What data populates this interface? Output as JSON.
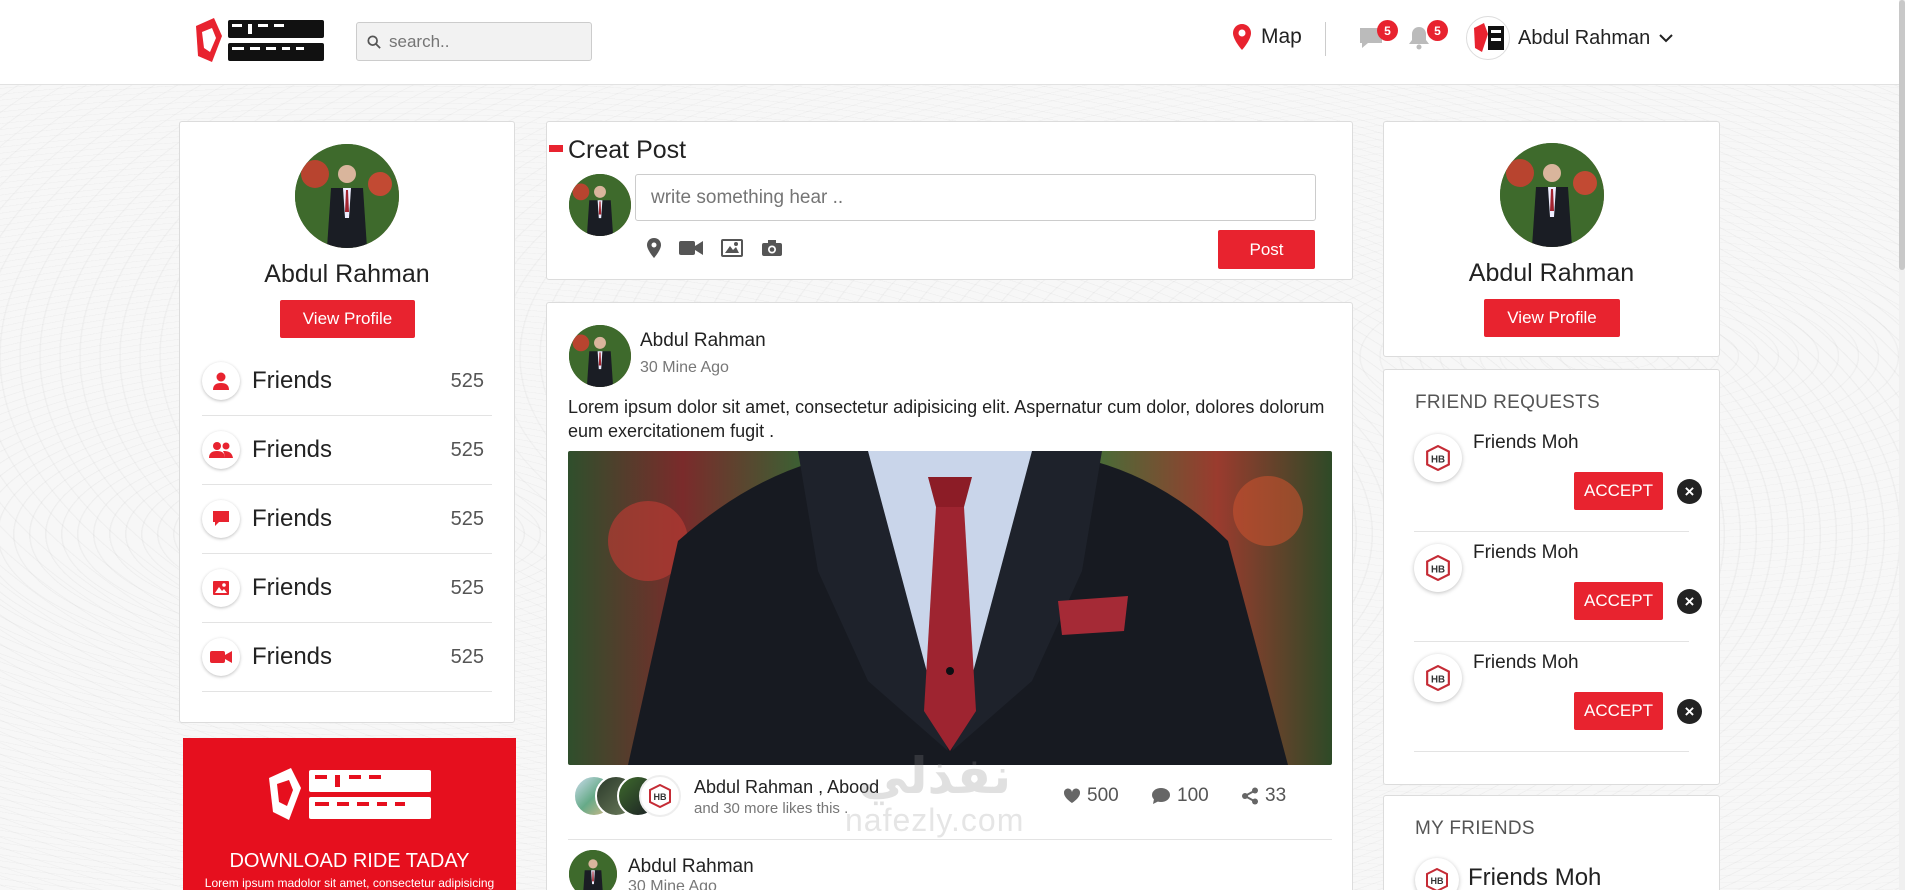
{
  "header": {
    "search_placeholder": "search..",
    "map_label": "Map",
    "messages_badge": "5",
    "notifications_badge": "5",
    "user_name": "Abdul Rahman"
  },
  "left": {
    "profile_name": "Abdul Rahman",
    "view_profile": "View Profile",
    "stats": [
      {
        "label": "Friends",
        "count": "525",
        "icon": "user-icon"
      },
      {
        "label": "Friends",
        "count": "525",
        "icon": "users-icon"
      },
      {
        "label": "Friends",
        "count": "525",
        "icon": "comment-icon"
      },
      {
        "label": "Friends",
        "count": "525",
        "icon": "image-icon"
      },
      {
        "label": "Friends",
        "count": "525",
        "icon": "video-icon"
      }
    ],
    "promo_title": "DOWNLOAD RIDE TADAY",
    "promo_text": "Lorem ipsum madolor sit amet, consectetur adipisicing"
  },
  "create_post": {
    "title": "Creat Post",
    "placeholder": "write something hear ..",
    "post_button": "Post"
  },
  "post": {
    "author": "Abdul Rahman",
    "time": "30 Mine Ago",
    "text": "Lorem ipsum dolor sit amet, consectetur adipisicing elit. Aspernatur cum dolor, dolores dolorum eum exercitationem fugit .",
    "likers": "Abdul Rahman , Abood",
    "likers_more": "and 30 more likes this .",
    "likes": "500",
    "comments": "100",
    "shares": "33"
  },
  "comment": {
    "author": "Abdul Rahman",
    "time": "30 Mine Ago"
  },
  "right": {
    "profile_name": "Abdul Rahman",
    "view_profile": "View Profile",
    "requests_title": "FRIEND REQUESTS",
    "requests": [
      {
        "name": "Friends Moh",
        "accept": "ACCEPT"
      },
      {
        "name": "Friends Moh",
        "accept": "ACCEPT"
      },
      {
        "name": "Friends Moh",
        "accept": "ACCEPT"
      }
    ],
    "friends_title": "MY FRIENDS",
    "friends": [
      {
        "name": "Friends Moh"
      }
    ]
  },
  "watermark": {
    "arabic": "نفذلي",
    "latin": "nafezly.com"
  },
  "colors": {
    "accent": "#e8232f",
    "dark": "#222222"
  }
}
